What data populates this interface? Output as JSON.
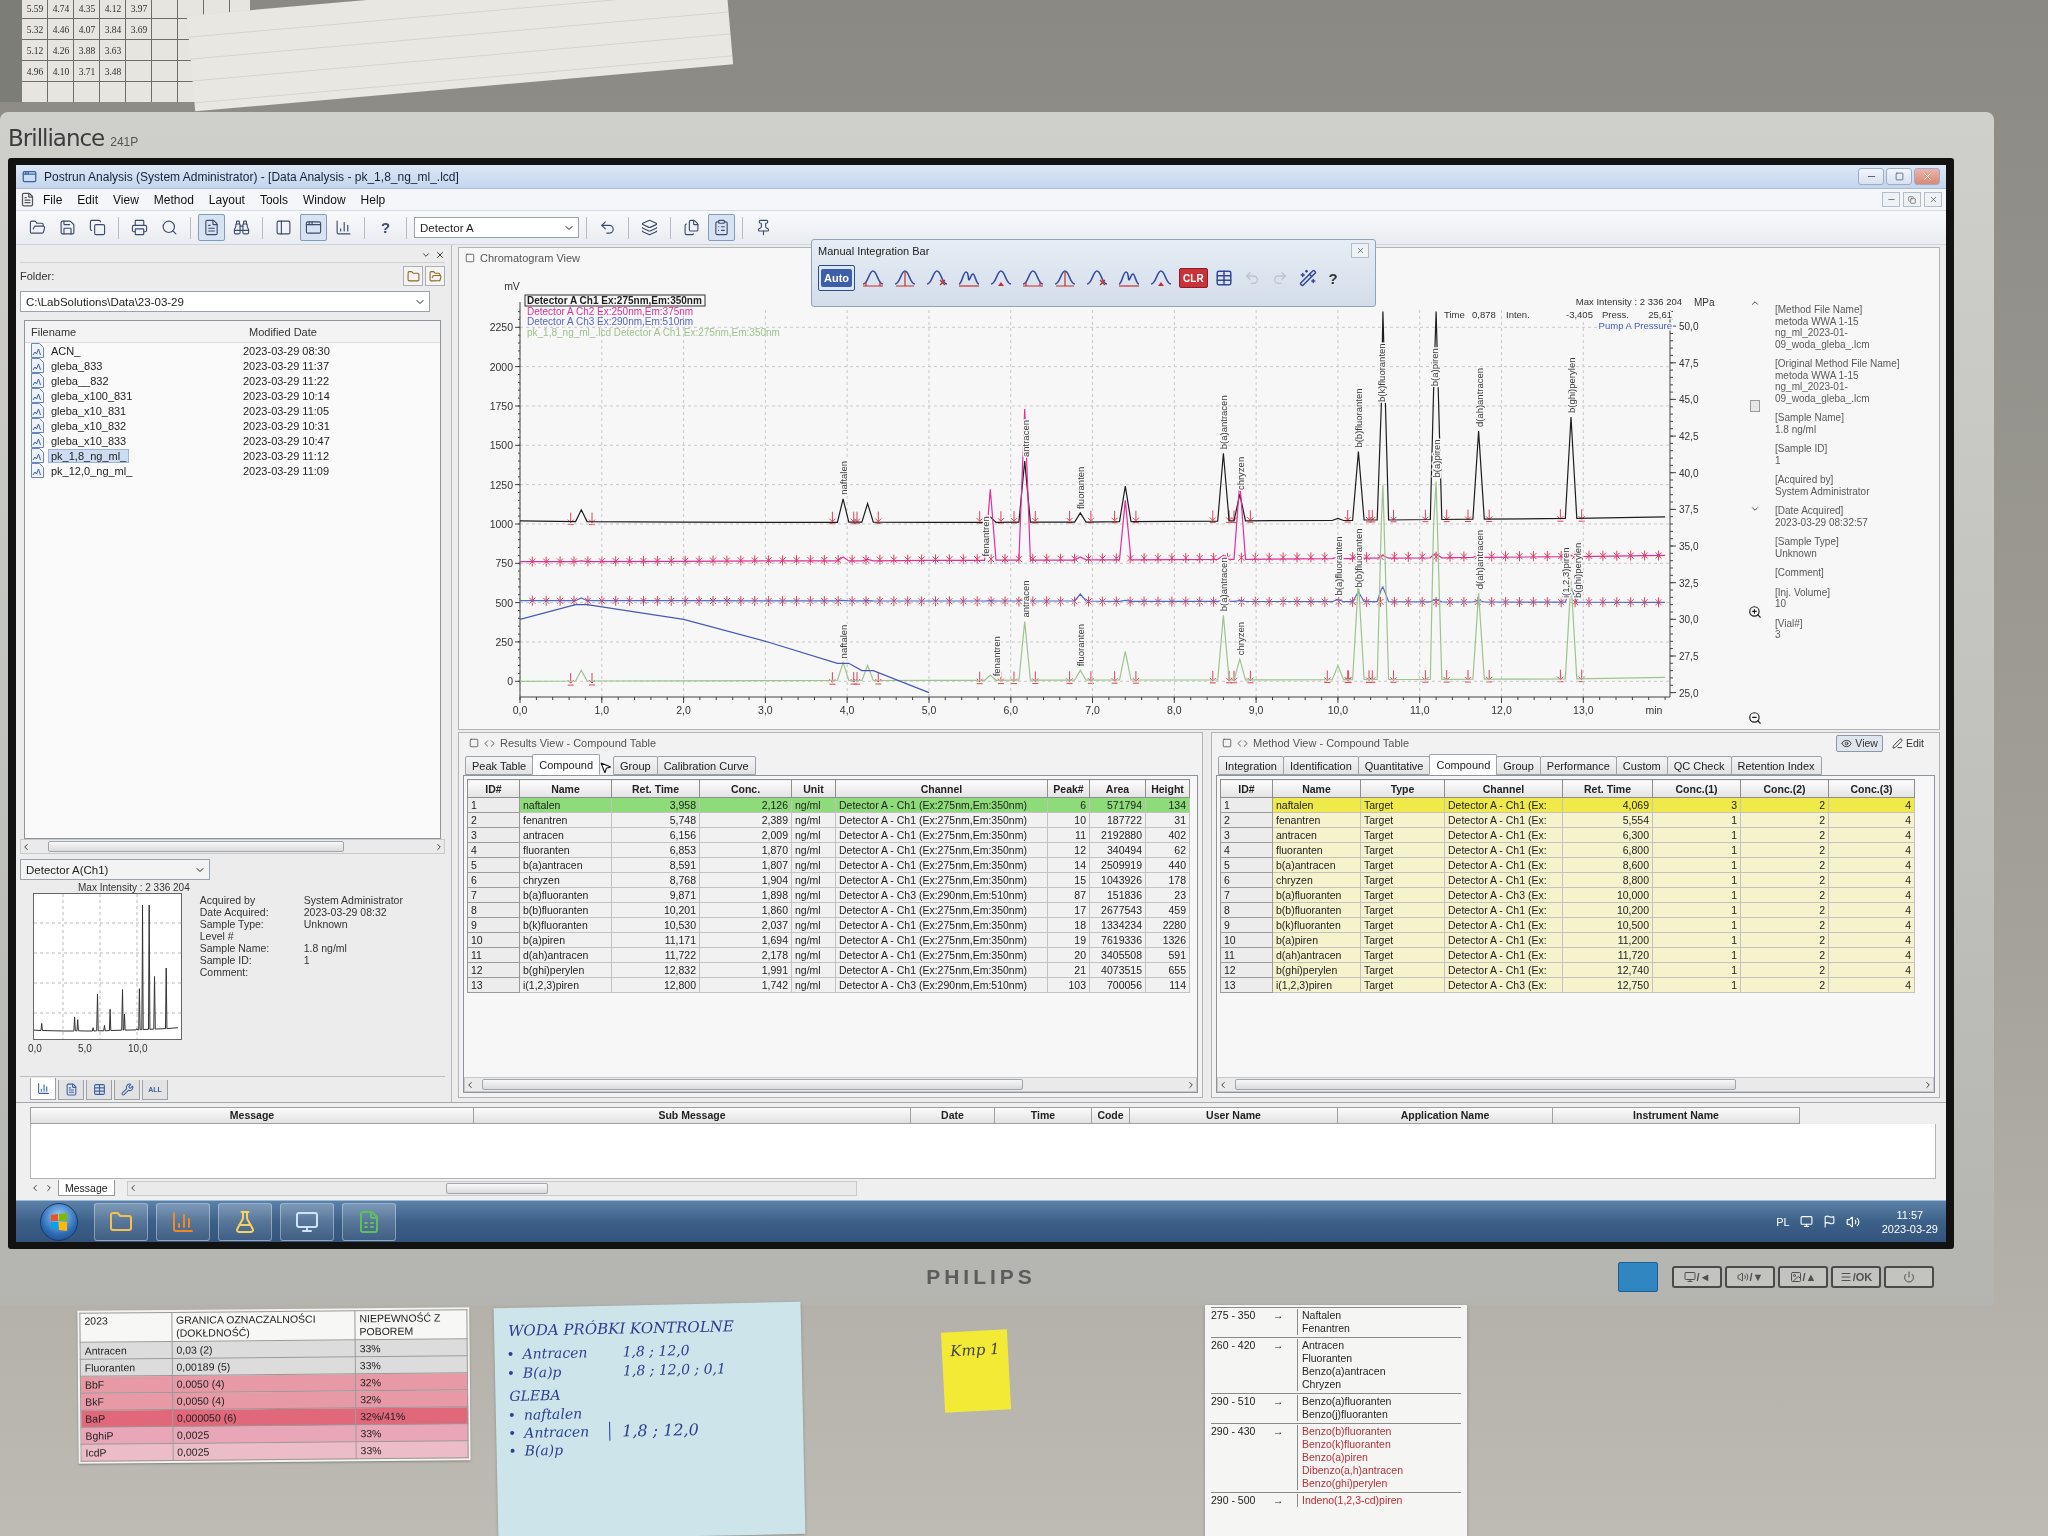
{
  "wall_table": {
    "rows": [
      [
        "5.59",
        "4.74",
        "4.35",
        "4.12",
        "3.97"
      ],
      [
        "5.32",
        "4.46",
        "4.07",
        "3.84",
        "3.69"
      ],
      [
        "5.12",
        "4.26",
        "3.88",
        "3.63"
      ],
      [
        "4.96",
        "4.10",
        "3.71",
        "3.48"
      ]
    ]
  },
  "monitor": {
    "model_name": "Brilliance",
    "model_number": "241P",
    "brand": "PHILIPS",
    "buttons": [
      {
        "kind": "input",
        "label": "/◄"
      },
      {
        "kind": "volume",
        "label": "/▼"
      },
      {
        "kind": "picture",
        "label": "/▲"
      },
      {
        "kind": "menu",
        "label": "/OK"
      },
      {
        "kind": "power"
      }
    ]
  },
  "window": {
    "title": "Postrun Analysis (System Administrator) - [Data Analysis - pk_1,8_ng_ml_.lcd]"
  },
  "menu": [
    "File",
    "Edit",
    "View",
    "Method",
    "Layout",
    "Tools",
    "Window",
    "Help"
  ],
  "toolbar": {
    "left": [
      [
        {
          "kind": "open",
          "pressed": false
        },
        {
          "kind": "save",
          "pressed": false
        },
        {
          "kind": "copy",
          "pressed": false
        }
      ],
      [
        {
          "kind": "print",
          "pressed": false
        },
        {
          "kind": "preview",
          "pressed": false
        }
      ],
      [
        {
          "kind": "document",
          "pressed": true
        },
        {
          "kind": "binoculars",
          "pressed": false
        }
      ],
      [
        {
          "kind": "panel",
          "pressed": false
        },
        {
          "kind": "window",
          "pressed": true
        },
        {
          "kind": "chart",
          "pressed": false
        }
      ],
      [
        {
          "kind": "help",
          "label": "?",
          "pressed": false
        }
      ]
    ],
    "detector": "Detector A",
    "right": [
      [
        {
          "kind": "undo",
          "pressed": false
        }
      ],
      [
        {
          "kind": "layers",
          "pressed": false
        }
      ],
      [
        {
          "kind": "duplicate",
          "pressed": false
        },
        {
          "kind": "report",
          "pressed": true
        }
      ],
      [
        {
          "kind": "pin",
          "pressed": false
        }
      ]
    ]
  },
  "integration_bar": {
    "title": "Manual Integration Bar",
    "tools": [
      {
        "kind": "auto",
        "label": "Auto",
        "selected": true,
        "disabled": false
      },
      {
        "kind": "peak",
        "selected": false,
        "disabled": false
      },
      {
        "kind": "peak",
        "selected": false,
        "disabled": false
      },
      {
        "kind": "peak",
        "selected": false,
        "disabled": false
      },
      {
        "kind": "peak",
        "selected": false,
        "disabled": false
      },
      {
        "kind": "peak",
        "selected": false,
        "disabled": false
      },
      {
        "kind": "peak",
        "selected": false,
        "disabled": false
      },
      {
        "kind": "peak",
        "selected": false,
        "disabled": false
      },
      {
        "kind": "peak",
        "selected": false,
        "disabled": false
      },
      {
        "kind": "peak",
        "selected": false,
        "disabled": false
      },
      {
        "kind": "peak",
        "selected": false,
        "disabled": false
      },
      {
        "kind": "clear",
        "label": "CLR",
        "selected": false,
        "disabled": false
      },
      {
        "kind": "table",
        "selected": false,
        "disabled": false
      },
      {
        "kind": "undo",
        "selected": false,
        "disabled": true
      },
      {
        "kind": "redo",
        "selected": false,
        "disabled": true
      },
      {
        "kind": "wizard",
        "selected": false,
        "disabled": false
      },
      {
        "kind": "help",
        "label": "?",
        "selected": false,
        "disabled": false
      }
    ]
  },
  "folder_panel": {
    "label": "Folder:",
    "path": "C:\\LabSolutions\\Data\\23-03-29",
    "columns": [
      "Filename",
      "Modified Date"
    ],
    "files": [
      {
        "name": "ACN_",
        "date": "2023-03-29 08:30",
        "selected": false
      },
      {
        "name": "gleba_833",
        "date": "2023-03-29 11:37",
        "selected": false
      },
      {
        "name": "gleba__832",
        "date": "2023-03-29 11:22",
        "selected": false
      },
      {
        "name": "gleba_x100_831",
        "date": "2023-03-29 10:14",
        "selected": false
      },
      {
        "name": "gleba_x10_831",
        "date": "2023-03-29 11:05",
        "selected": false
      },
      {
        "name": "gleba_x10_832",
        "date": "2023-03-29 10:31",
        "selected": false
      },
      {
        "name": "gleba_x10_833",
        "date": "2023-03-29 10:47",
        "selected": false
      },
      {
        "name": "pk_1,8_ng_ml_",
        "date": "2023-03-29 11:12",
        "selected": true
      },
      {
        "name": "pk_12,0_ng_ml_",
        "date": "2023-03-29 11:09",
        "selected": false
      }
    ]
  },
  "preview": {
    "detector": "Detector A(Ch1)",
    "max_intensity": "Max Intensity : 2 336 204",
    "xticks": [
      "0,0",
      "5,0",
      "10,0"
    ],
    "info": [
      {
        "label": "Acquired by",
        "value": "System Administrator"
      },
      {
        "label": "Date Acquired:",
        "value": "2023-03-29 08:32"
      },
      {
        "label": "Sample Type:",
        "value": "Unknown"
      },
      {
        "label": "Level #"
      },
      {
        "label": "Sample Name:",
        "value": "1.8 ng/ml"
      },
      {
        "label": "Sample ID:",
        "value": "1"
      },
      {
        "label": "Comment:"
      }
    ],
    "tabs": [
      {
        "kind": "chromatogram",
        "selected": true
      },
      {
        "kind": "report",
        "selected": false
      },
      {
        "kind": "table",
        "selected": false
      },
      {
        "kind": "tool",
        "selected": false
      },
      {
        "kind": "all",
        "label": "ALL",
        "selected": false
      }
    ]
  },
  "chromatogram_view": {
    "title": "Chromatogram View",
    "legend": [
      {
        "selected": true
      },
      {
        "selected": false
      },
      {
        "selected": false
      },
      {
        "selected": false
      }
    ],
    "integration_marks": [
      {
        "kind": "peaks"
      },
      {
        "kind": "dense"
      },
      {
        "kind": "dense"
      },
      {
        "kind": "peaks"
      }
    ],
    "chart_data": {
      "type": "line",
      "grid": true,
      "xlabel": "min",
      "ylabel": "mV",
      "y2label": "MPa",
      "xlim": [
        0,
        14.06
      ],
      "ylim": [
        -100,
        2360
      ],
      "y2lim": [
        24.7,
        51.1
      ],
      "x": [
        0,
        0.68,
        0.75,
        0.82,
        2.0,
        3.0,
        3.88,
        3.95,
        4.02,
        4.18,
        4.25,
        4.32,
        5.0,
        5.68,
        5.75,
        5.82,
        6.1,
        6.17,
        6.24,
        6.78,
        6.85,
        6.92,
        7.33,
        7.4,
        7.47,
        8.53,
        8.6,
        8.67,
        8.73,
        8.8,
        8.87,
        9.93,
        10.0,
        10.07,
        10.18,
        10.25,
        10.32,
        10.48,
        10.53,
        10.55,
        10.62,
        11.13,
        11.17,
        11.2,
        11.27,
        11.65,
        11.72,
        11.79,
        12.78,
        12.85,
        12.92,
        14.0
      ],
      "series": [
        {
          "name": "Detector A Ch1 Ex:275nm,Em:350nm",
          "color": "#1e1e1e",
          "values": [
            1020,
            1015,
            1090,
            1015,
            1012,
            1010,
            1010,
            1160,
            1012,
            1012,
            1130,
            1012,
            1010,
            1010,
            1045,
            1010,
            1012,
            1400,
            1012,
            1012,
            1070,
            1012,
            1015,
            1240,
            1015,
            1018,
            1450,
            1020,
            1020,
            1190,
            1020,
            1022,
            1035,
            1022,
            1022,
            1460,
            1025,
            1025,
            1750,
            2350,
            1025,
            1028,
            1850,
            2350,
            1028,
            1030,
            1590,
            1030,
            1035,
            1680,
            1035,
            1045
          ]
        },
        {
          "name": "Detector A Ch2 Ex:250nm,Em:375nm",
          "color": "#e0309a",
          "values": [
            760,
            760,
            765,
            760,
            762,
            765,
            765,
            790,
            765,
            765,
            775,
            765,
            768,
            768,
            1220,
            770,
            770,
            1730,
            770,
            770,
            790,
            772,
            772,
            1150,
            772,
            775,
            800,
            775,
            775,
            1270,
            775,
            780,
            790,
            780,
            780,
            800,
            782,
            782,
            795,
            800,
            782,
            785,
            805,
            810,
            785,
            788,
            800,
            788,
            792,
            800,
            792,
            800
          ]
        },
        {
          "name": "Detector A Ch3 Ex:290nm,Em:510nm",
          "color": "#5568c4",
          "values": [
            512,
            512,
            530,
            512,
            512,
            511,
            511,
            515,
            511,
            511,
            512,
            511,
            510,
            510,
            512,
            510,
            510,
            520,
            510,
            510,
            555,
            510,
            508,
            515,
            508,
            508,
            515,
            508,
            508,
            512,
            508,
            506,
            520,
            506,
            506,
            570,
            506,
            506,
            585,
            600,
            506,
            505,
            515,
            520,
            505,
            504,
            515,
            504,
            503,
            600,
            503,
            502
          ]
        },
        {
          "name": "pk_1,8_ng_ml_.lcd Detector A Ch1 Ex:275nm,Em:350nm",
          "color": "#9cc48c",
          "values": [
            0,
            2,
            70,
            2,
            3,
            4,
            5,
            120,
            5,
            5,
            100,
            5,
            6,
            6,
            40,
            6,
            7,
            380,
            7,
            7,
            70,
            7,
            8,
            190,
            8,
            9,
            420,
            9,
            9,
            140,
            9,
            10,
            100,
            10,
            10,
            640,
            11,
            11,
            1000,
            1250,
            11,
            12,
            1000,
            1270,
            12,
            13,
            560,
            13,
            15,
            640,
            15,
            25
          ]
        },
        {
          "name": "Pump A Pressure",
          "color": "#4658b8",
          "axis": "y2",
          "values": [
            30.0,
            31.0,
            31.0,
            31.0,
            30.0,
            28.5,
            27.0,
            27.0,
            27.0,
            26.5,
            26.5,
            26.5,
            25.0,
            null,
            null,
            null,
            null,
            null,
            null,
            null,
            null,
            null,
            null,
            null,
            null,
            null,
            null,
            null,
            null,
            null,
            null,
            null,
            null,
            null,
            null,
            null,
            null,
            null,
            null,
            null,
            null,
            null,
            null,
            null,
            null,
            null,
            null,
            null,
            null,
            null,
            null,
            null
          ]
        }
      ],
      "xticks": [
        {
          "value": 0,
          "label": "0,0"
        },
        {
          "value": 1,
          "label": "1,0"
        },
        {
          "value": 2,
          "label": "2,0"
        },
        {
          "value": 3,
          "label": "3,0"
        },
        {
          "value": 4,
          "label": "4,0"
        },
        {
          "value": 5,
          "label": "5,0"
        },
        {
          "value": 6,
          "label": "6,0"
        },
        {
          "value": 7,
          "label": "7,0"
        },
        {
          "value": 8,
          "label": "8,0"
        },
        {
          "value": 9,
          "label": "9,0"
        },
        {
          "value": 10,
          "label": "10,0"
        },
        {
          "value": 11,
          "label": "11,0"
        },
        {
          "value": 12,
          "label": "12,0"
        },
        {
          "value": 13,
          "label": "13,0"
        }
      ],
      "yticks": [
        0,
        250,
        500,
        750,
        1000,
        1250,
        1500,
        1750,
        2000,
        2250
      ],
      "y2ticks": [
        {
          "value": 25,
          "label": "25,0"
        },
        {
          "value": 27.5,
          "label": "27,5"
        },
        {
          "value": 30,
          "label": "30,0"
        },
        {
          "value": 32.5,
          "label": "32,5"
        },
        {
          "value": 35,
          "label": "35,0"
        },
        {
          "value": 37.5,
          "label": "37,5"
        },
        {
          "value": 40,
          "label": "40,0"
        },
        {
          "value": 42.5,
          "label": "42,5"
        },
        {
          "value": 45,
          "label": "45,0"
        },
        {
          "value": 47.5,
          "label": "47,5"
        },
        {
          "value": 50,
          "label": "50,0"
        }
      ],
      "annotations": [
        {
          "x": 3.95,
          "y": 1160,
          "text": "naftalen"
        },
        {
          "x": 5.68,
          "y": 768,
          "text": "fenantren"
        },
        {
          "x": 6.17,
          "y": 1400,
          "text": "antracen"
        },
        {
          "x": 6.85,
          "y": 1070,
          "text": "fluoranten"
        },
        {
          "x": 8.6,
          "y": 1450,
          "text": "b(a)antracen"
        },
        {
          "x": 8.8,
          "y": 1190,
          "text": "chryzen"
        },
        {
          "x": 10.25,
          "y": 1460,
          "text": "b(b)fluoranten"
        },
        {
          "x": 10.53,
          "y": 1750,
          "text": "b(k)fluoranten"
        },
        {
          "x": 11.17,
          "y": 1850,
          "text": "b(a)piren"
        },
        {
          "x": 11.72,
          "y": 1590,
          "text": "d(ah)antracen"
        },
        {
          "x": 12.85,
          "y": 1680,
          "text": "b(ghi)perylen"
        },
        {
          "x": 6.17,
          "y": 380,
          "text": "antracen"
        },
        {
          "x": 8.6,
          "y": 420,
          "text": "b(a)antracen"
        },
        {
          "x": 10.0,
          "y": 520,
          "text": "b(a)fluoranten"
        },
        {
          "x": 10.25,
          "y": 570,
          "text": "b(b)fluoranten"
        },
        {
          "x": 11.2,
          "y": 1270,
          "text": "b(a)piren"
        },
        {
          "x": 11.72,
          "y": 560,
          "text": "d(ah)antracen"
        },
        {
          "x": 12.78,
          "y": 503,
          "text": "i(1,2,3)piren"
        },
        {
          "x": 12.92,
          "y": 503,
          "text": "b(ghi)perylen"
        },
        {
          "x": 3.95,
          "y": 120,
          "text": "naftalen"
        },
        {
          "x": 5.82,
          "y": 6,
          "text": "fenantren"
        },
        {
          "x": 6.85,
          "y": 70,
          "text": "fluoranten"
        },
        {
          "x": 8.8,
          "y": 140,
          "text": "chryzen"
        }
      ]
    },
    "readout": {
      "max_intensity": "Max Intensity : 2 336 204",
      "time_label": "Time",
      "time": "0,878",
      "intensity_label": "Inten.",
      "intensity": "-3,405",
      "pressure_label": "Press.",
      "pressure": "25,61"
    },
    "info": [
      {
        "label": "[Method File Name]",
        "value": "metoda WWA 1-15 ng_ml_2023-01-09_woda_gleba_.lcm"
      },
      {
        "label": "[Original Method File Name]",
        "value": "metoda WWA 1-15 ng_ml_2023-01-09_woda_gleba_.lcm"
      },
      {
        "label": "[Sample Name]",
        "value": "1.8 ng/ml"
      },
      {
        "label": "[Sample ID]",
        "value": "1"
      },
      {
        "label": "[Acquired by]",
        "value": "System Administrator"
      },
      {
        "label": "[Date Acquired]",
        "value": "2023-03-29 08:32:57"
      },
      {
        "label": "[Sample Type]",
        "value": "Unknown"
      },
      {
        "label": "[Comment]"
      },
      {
        "label": "[Inj. Volume]",
        "value": "10"
      },
      {
        "label": "[Vial#]",
        "value": "3"
      }
    ]
  },
  "results_view": {
    "title": "Results View - Compound Table",
    "tabs": [
      {
        "label": "Peak Table",
        "selected": false
      },
      {
        "label": "Compound",
        "selected": true
      },
      {
        "label": "Group",
        "selected": false
      },
      {
        "label": "Calibration Curve",
        "selected": false
      }
    ],
    "columns": [
      "ID#",
      "Name",
      "Ret. Time",
      "Conc.",
      "Unit",
      "Channel",
      "Peak#",
      "Area",
      "Height"
    ],
    "rows": [
      {
        "cells": [
          "1",
          "naftalen",
          "3,958",
          "2,126",
          "ng/ml",
          "Detector A - Ch1 (Ex:275nm,Em:350nm)",
          "6",
          "571794",
          "134"
        ],
        "selected": true
      },
      {
        "cells": [
          "2",
          "fenantren",
          "5,748",
          "2,389",
          "ng/ml",
          "Detector A - Ch1 (Ex:275nm,Em:350nm)",
          "10",
          "187722",
          "31"
        ],
        "selected": false
      },
      {
        "cells": [
          "3",
          "antracen",
          "6,156",
          "2,009",
          "ng/ml",
          "Detector A - Ch1 (Ex:275nm,Em:350nm)",
          "11",
          "2192880",
          "402"
        ],
        "selected": false
      },
      {
        "cells": [
          "4",
          "fluoranten",
          "6,853",
          "1,870",
          "ng/ml",
          "Detector A - Ch1 (Ex:275nm,Em:350nm)",
          "12",
          "340494",
          "62"
        ],
        "selected": false
      },
      {
        "cells": [
          "5",
          "b(a)antracen",
          "8,591",
          "1,807",
          "ng/ml",
          "Detector A - Ch1 (Ex:275nm,Em:350nm)",
          "14",
          "2509919",
          "440"
        ],
        "selected": false
      },
      {
        "cells": [
          "6",
          "chryzen",
          "8,768",
          "1,904",
          "ng/ml",
          "Detector A - Ch1 (Ex:275nm,Em:350nm)",
          "15",
          "1043926",
          "178"
        ],
        "selected": false
      },
      {
        "cells": [
          "7",
          "b(a)fluoranten",
          "9,871",
          "1,898",
          "ng/ml",
          "Detector A - Ch3 (Ex:290nm,Em:510nm)",
          "87",
          "151836",
          "23"
        ],
        "selected": false
      },
      {
        "cells": [
          "8",
          "b(b)fluoranten",
          "10,201",
          "1,860",
          "ng/ml",
          "Detector A - Ch1 (Ex:275nm,Em:350nm)",
          "17",
          "2677543",
          "459"
        ],
        "selected": false
      },
      {
        "cells": [
          "9",
          "b(k)fluoranten",
          "10,530",
          "2,037",
          "ng/ml",
          "Detector A - Ch1 (Ex:275nm,Em:350nm)",
          "18",
          "1334234",
          "2280"
        ],
        "selected": false
      },
      {
        "cells": [
          "10",
          "b(a)piren",
          "11,171",
          "1,694",
          "ng/ml",
          "Detector A - Ch1 (Ex:275nm,Em:350nm)",
          "19",
          "7619336",
          "1326"
        ],
        "selected": false
      },
      {
        "cells": [
          "11",
          "d(ah)antracen",
          "11,722",
          "2,178",
          "ng/ml",
          "Detector A - Ch1 (Ex:275nm,Em:350nm)",
          "20",
          "3405508",
          "591"
        ],
        "selected": false
      },
      {
        "cells": [
          "12",
          "b(ghi)perylen",
          "12,832",
          "1,991",
          "ng/ml",
          "Detector A - Ch1 (Ex:275nm,Em:350nm)",
          "21",
          "4073515",
          "655"
        ],
        "selected": false
      },
      {
        "cells": [
          "13",
          "i(1,2,3)piren",
          "12,800",
          "1,742",
          "ng/ml",
          "Detector A - Ch3 (Ex:290nm,Em:510nm)",
          "103",
          "700056",
          "114"
        ],
        "selected": false
      }
    ]
  },
  "method_view": {
    "title": "Method View - Compound Table",
    "buttons": [
      {
        "kind": "view",
        "label": "View",
        "pressed": true
      },
      {
        "kind": "edit",
        "label": "Edit",
        "pressed": false
      }
    ],
    "tabs": [
      {
        "label": "Integration",
        "selected": false
      },
      {
        "label": "Identification",
        "selected": false
      },
      {
        "label": "Quantitative",
        "selected": false
      },
      {
        "label": "Compound",
        "selected": true
      },
      {
        "label": "Group",
        "selected": false
      },
      {
        "label": "Performance",
        "selected": false
      },
      {
        "label": "Custom",
        "selected": false
      },
      {
        "label": "QC Check",
        "selected": false
      },
      {
        "label": "Retention Index",
        "selected": false
      }
    ],
    "columns": [
      "ID#",
      "Name",
      "Type",
      "Channel",
      "Ret. Time",
      "Conc.(1)",
      "Conc.(2)",
      "Conc.(3)"
    ],
    "rows": [
      {
        "cells": [
          "1",
          "naftalen",
          "Target",
          "Detector A - Ch1 (Ex:",
          "4,069",
          "3",
          "2",
          "4"
        ],
        "selected": true
      },
      {
        "cells": [
          "2",
          "fenantren",
          "Target",
          "Detector A - Ch1 (Ex:",
          "5,554",
          "1",
          "2",
          "4"
        ],
        "selected": false
      },
      {
        "cells": [
          "3",
          "antracen",
          "Target",
          "Detector A - Ch1 (Ex:",
          "6,300",
          "1",
          "2",
          "4"
        ],
        "selected": false
      },
      {
        "cells": [
          "4",
          "fluoranten",
          "Target",
          "Detector A - Ch1 (Ex:",
          "6,800",
          "1",
          "2",
          "4"
        ],
        "selected": false
      },
      {
        "cells": [
          "5",
          "b(a)antracen",
          "Target",
          "Detector A - Ch1 (Ex:",
          "8,600",
          "1",
          "2",
          "4"
        ],
        "selected": false
      },
      {
        "cells": [
          "6",
          "chryzen",
          "Target",
          "Detector A - Ch1 (Ex:",
          "8,800",
          "1",
          "2",
          "4"
        ],
        "selected": false
      },
      {
        "cells": [
          "7",
          "b(a)fluoranten",
          "Target",
          "Detector A - Ch3 (Ex:",
          "10,000",
          "1",
          "2",
          "4"
        ],
        "selected": false
      },
      {
        "cells": [
          "8",
          "b(b)fluoranten",
          "Target",
          "Detector A - Ch1 (Ex:",
          "10,200",
          "1",
          "2",
          "4"
        ],
        "selected": false
      },
      {
        "cells": [
          "9",
          "b(k)fluoranten",
          "Target",
          "Detector A - Ch1 (Ex:",
          "10,500",
          "1",
          "2",
          "4"
        ],
        "selected": false
      },
      {
        "cells": [
          "10",
          "b(a)piren",
          "Target",
          "Detector A - Ch1 (Ex:",
          "11,200",
          "1",
          "2",
          "4"
        ],
        "selected": false
      },
      {
        "cells": [
          "11",
          "d(ah)antracen",
          "Target",
          "Detector A - Ch1 (Ex:",
          "11,720",
          "1",
          "2",
          "4"
        ],
        "selected": false
      },
      {
        "cells": [
          "12",
          "b(ghi)perylen",
          "Target",
          "Detector A - Ch1 (Ex:",
          "12,740",
          "1",
          "2",
          "4"
        ],
        "selected": false
      },
      {
        "cells": [
          "13",
          "i(1,2,3)piren",
          "Target",
          "Detector A - Ch3 (Ex:",
          "12,750",
          "1",
          "2",
          "4"
        ],
        "selected": false
      }
    ]
  },
  "message_log": {
    "columns": [
      "Message",
      "Sub Message",
      "Date",
      "Time",
      "Code",
      "User Name",
      "Application Name",
      "Instrument Name"
    ],
    "tabs": [
      {
        "label": "Message",
        "selected": true
      }
    ]
  },
  "taskbar": {
    "apps": [
      {
        "kind": "explorer"
      },
      {
        "kind": "chart"
      },
      {
        "kind": "flask"
      },
      {
        "kind": "monitor"
      },
      {
        "kind": "sheet"
      }
    ],
    "language": "PL",
    "time": "11:57",
    "date": "2023-03-29"
  },
  "desk": {
    "limits_table": {
      "columns": [
        "2023",
        "GRANICA OZNACZALNOŚCI (DOKŁDNOŚĆ)",
        "NIEPEWNOŚĆ Z POBOREM"
      ],
      "rows": [
        {
          "cells": [
            "Antracen",
            "0,03 (2)",
            "33%"
          ],
          "color": "#dcdcdc"
        },
        {
          "cells": [
            "Fluoranten",
            "0,00189 (5)",
            "33%"
          ],
          "color": "#dcdcdc"
        },
        {
          "cells": [
            "BbF",
            "0,0050 (4)",
            "32%"
          ],
          "color": "#e79aa6"
        },
        {
          "cells": [
            "BkF",
            "0,0050 (4)",
            "32%"
          ],
          "color": "#e79aa6"
        },
        {
          "cells": [
            "BaP",
            "0,000050 (6)",
            "32%/41%"
          ],
          "color": "#e0687a"
        },
        {
          "cells": [
            "BghiP",
            "0,0025",
            "33%"
          ],
          "color": "#e8a6b8"
        },
        {
          "cells": [
            "IcdP",
            "0,0025",
            "33%"
          ],
          "color": "#ecbcc8"
        }
      ]
    },
    "note": {
      "title": "WODA PRÓBKI KONTROLNE",
      "items": [
        {
          "name": "Antracen",
          "values": "1,8 ; 12,0"
        },
        {
          "name": "B(a)p",
          "values": "1,8 ; 12,0 ; 0,1"
        }
      ],
      "section": "GLEBA",
      "section_items": [
        "naftalen",
        "Antracen",
        "B(a)p"
      ],
      "section_values": "1,8 ; 12,0"
    },
    "tag": "Kmp 1",
    "wavelength_sheet": [
      {
        "range": "275 - 350",
        "arrow": "→",
        "color": "#262626",
        "compounds": [
          "Naftalen",
          "Fenantren"
        ]
      },
      {
        "range": "260 - 420",
        "arrow": "→",
        "color": "#262626",
        "compounds": [
          "Antracen",
          "Fluoranten",
          "Benzo(a)antracen",
          "Chryzen"
        ]
      },
      {
        "range": "290 - 510",
        "arrow": "→",
        "color": "#262626",
        "compounds": [
          "Benzo(a)fluoranten",
          "Benzo(j)fluoranten"
        ]
      },
      {
        "range": "290 - 430",
        "arrow": "→",
        "color": "#b0343a",
        "compounds": [
          "Benzo(b)fluoranten",
          "Benzo(k)fluoranten",
          "Benzo(a)piren",
          "Dibenzo(a,h)antracen",
          "Benzo(ghi)perylen"
        ]
      },
      {
        "range": "290 - 500",
        "arrow": "→",
        "color": "#c02a30",
        "compounds": [
          "Indeno(1,2,3-cd)piren"
        ]
      }
    ]
  }
}
